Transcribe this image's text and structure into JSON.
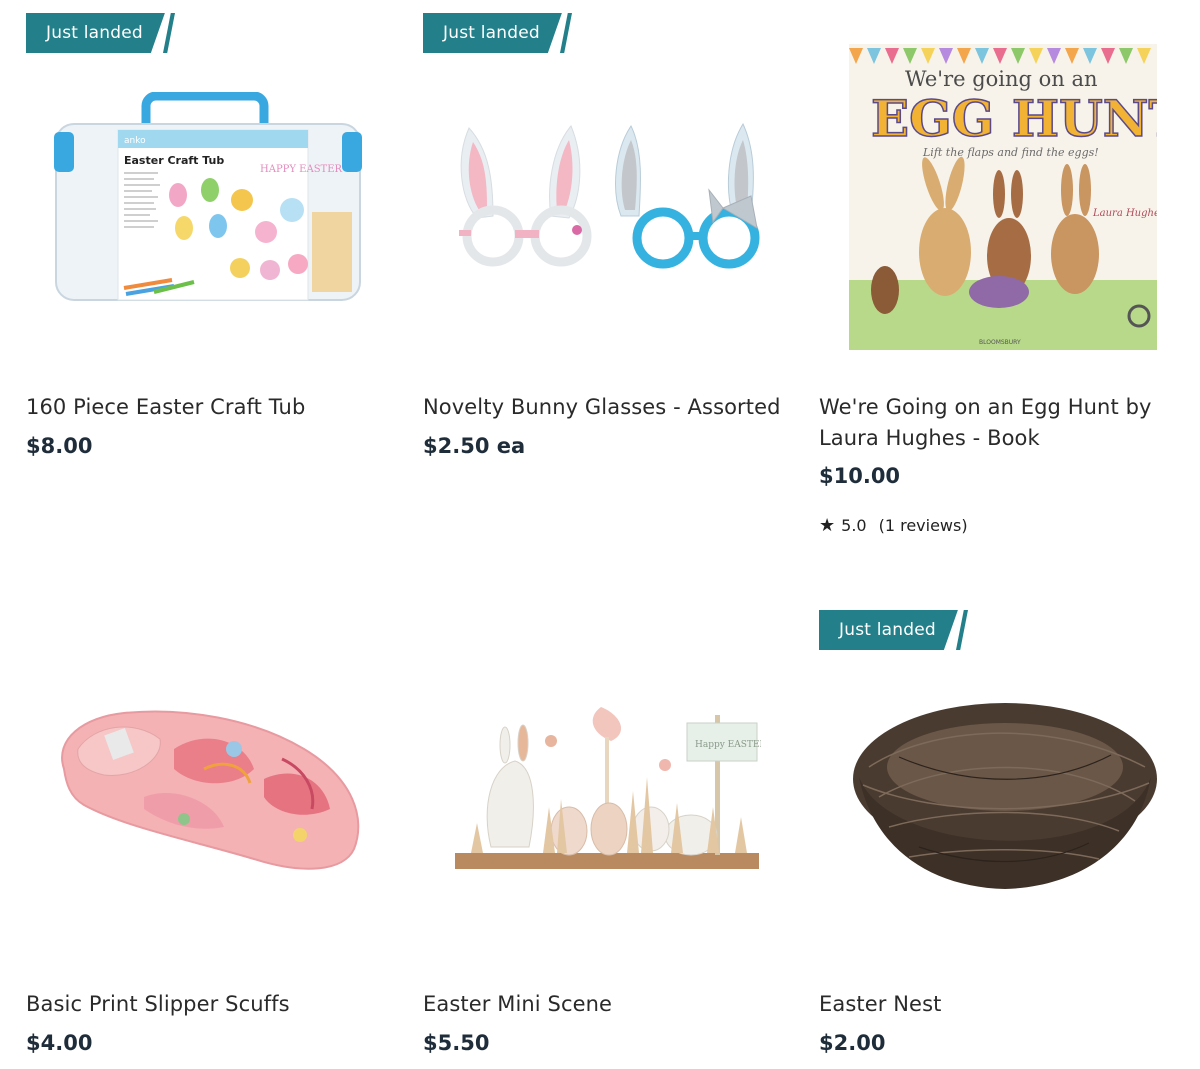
{
  "products": [
    {
      "badge": "Just landed",
      "title": "160 Piece Easter Craft Tub",
      "price": "$8.00",
      "image_icon": "craft-tub-image",
      "tub_label": "Easter Craft Tub",
      "tub_brand": "anko",
      "tub_stamp": "HAPPY EASTER"
    },
    {
      "badge": "Just landed",
      "title": "Novelty Bunny Glasses - Assorted",
      "price": "$2.50 ea",
      "image_icon": "bunny-glasses-image"
    },
    {
      "badge": "",
      "title": "We're Going on an Egg Hunt by Laura Hughes - Book",
      "price": "$10.00",
      "rating": "5.0",
      "reviews": "(1 reviews)",
      "image_icon": "egg-hunt-book-image",
      "cover_line1": "We're going on an",
      "cover_line2": "EGG HUNT",
      "cover_line3": "Lift the flaps and find the eggs!",
      "cover_author": "Laura Hughes",
      "cover_publisher": "BLOOMSBURY"
    },
    {
      "badge": "",
      "title": "Basic Print Slipper Scuffs",
      "price": "$4.00",
      "image_icon": "slipper-image"
    },
    {
      "badge": "",
      "title": "Easter Mini Scene",
      "price": "$5.50",
      "image_icon": "easter-scene-image",
      "sign_text": "Happy EASTER"
    },
    {
      "badge": "Just landed",
      "title": "Easter Nest",
      "price": "$2.00",
      "image_icon": "nest-image"
    }
  ],
  "colors": {
    "badge": "#23808a",
    "price": "#1f2d3a"
  }
}
